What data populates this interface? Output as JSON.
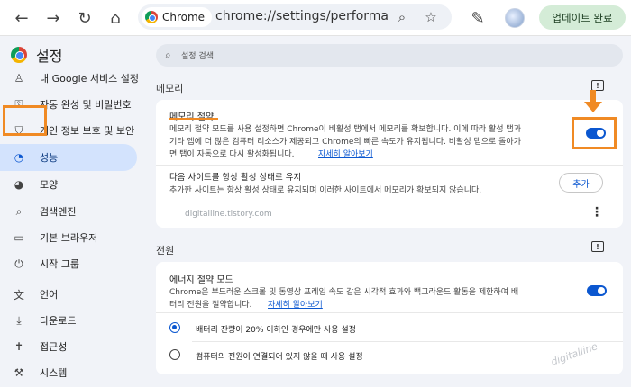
{
  "browser": {
    "tab_chip": "Chrome",
    "url": "chrome://settings/performa",
    "update_button": "업데이트 완료"
  },
  "sidebar": {
    "title": "설정",
    "items": [
      {
        "label": "내 Google 서비스 설정",
        "icon": "person-icon"
      },
      {
        "label": "자동 완성 및 비밀번호",
        "icon": "key-icon"
      },
      {
        "label": "개인 정보 보호 및 보안",
        "icon": "shield-icon"
      },
      {
        "label": "성능",
        "icon": "speedometer-icon",
        "active": true
      },
      {
        "label": "모양",
        "icon": "palette-icon"
      },
      {
        "label": "검색엔진",
        "icon": "search-icon"
      },
      {
        "label": "기본 브라우저",
        "icon": "browser-icon"
      },
      {
        "label": "시작 그룹",
        "icon": "power-icon"
      },
      {
        "label": "언어",
        "icon": "translate-icon"
      },
      {
        "label": "다운로드",
        "icon": "download-icon"
      },
      {
        "label": "접근성",
        "icon": "accessibility-icon"
      },
      {
        "label": "시스템",
        "icon": "wrench-icon"
      }
    ]
  },
  "search": {
    "placeholder": "설정 검색"
  },
  "memory": {
    "section_title": "메모리",
    "saver_title": "메모리 절약",
    "desc_line1": "메모리 절약 모드를 사용 설정하면 Chrome이 비활성 탭에서 메모리를 확보합니다. 이에 따라 활성 탭과",
    "desc_line2": "기타 앱에 더 많은 컴퓨터 리소스가 제공되고 Chrome의 빠른 속도가 유지됩니다. 비활성 탭으로 돌아가",
    "desc_line3": "면 탭이 자동으로 다시 활성화됩니다.",
    "learn_more": "자세히 알아보기",
    "toggle_on": true,
    "always_active_title": "다음 사이트를 항상 활성 상태로 유지",
    "always_active_desc": "추가한 사이트는 항상 활성 상태로 유지되며 이러한 사이트에서 메모리가 확보되지 않습니다.",
    "add_button": "추가",
    "watermark": "digitalline.tistory.com"
  },
  "power": {
    "section_title": "전원",
    "energy_title": "에너지 절약 모드",
    "desc_line1": "Chrome은 부드러운 스크롤 및 동영상 프레임 속도 같은 시각적 효과와 백그라운드 활동을 제한하여 배",
    "desc_line2": "터리 전원을 절약합니다.",
    "learn_more": "자세히 알아보기",
    "toggle_on": true,
    "option1": "배터리 잔량이 20% 이하인 경우에만 사용 설정",
    "option2": "컴퓨터의 전원이 연결되어 있지 않을 때 사용 설정",
    "watermark": "digitalline"
  },
  "colors": {
    "accent": "#0b57d0",
    "highlight": "#f08a24"
  }
}
